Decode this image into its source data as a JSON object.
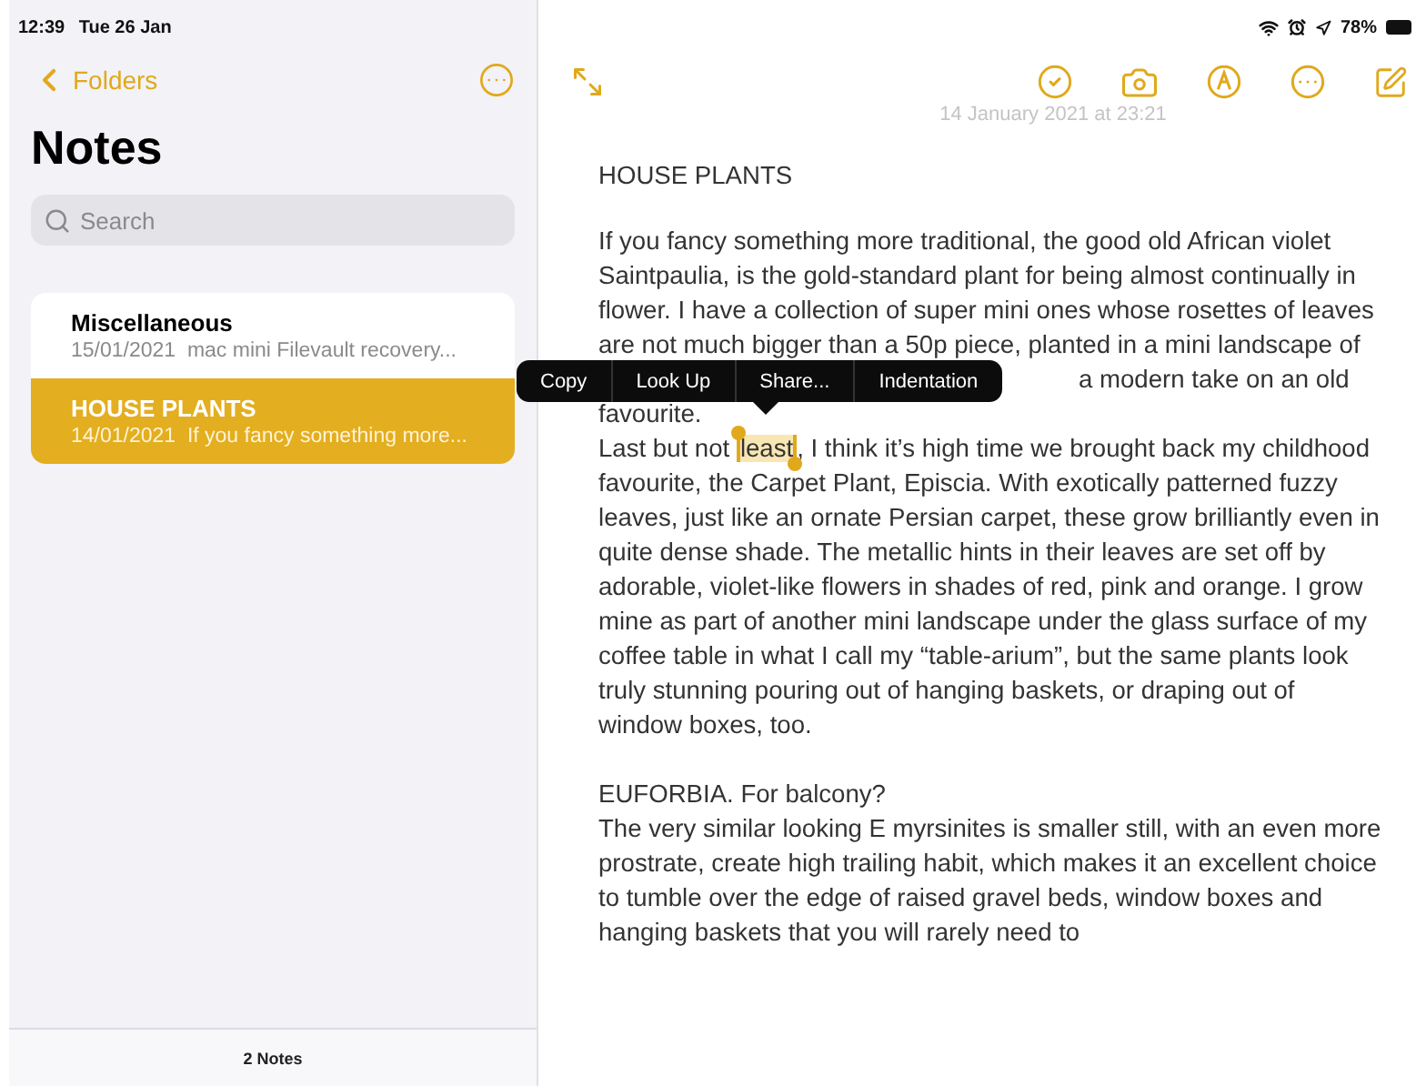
{
  "status_bar": {
    "time": "12:39",
    "date": "Tue 26 Jan",
    "battery": "78%"
  },
  "sidebar": {
    "back_label": "Folders",
    "title": "Notes",
    "search": {
      "placeholder": "Search"
    },
    "notes": [
      {
        "title": "Miscellaneous",
        "date": "15/01/2021",
        "preview": "mac mini Filevault recovery...",
        "selected": false
      },
      {
        "title": "HOUSE PLANTS",
        "date": "14/01/2021",
        "preview": "If you fancy something more...",
        "selected": true
      }
    ],
    "footer": "2 Notes"
  },
  "editor": {
    "date": "14 January 2021 at 23:21",
    "heading": "HOUSE PLANTS",
    "lines": [
      {
        "kind": "text",
        "text": "If you fancy something more traditional, the good old African violet"
      },
      {
        "kind": "text",
        "text": "Saintpaulia, is the gold-standard plant for being almost continually in"
      },
      {
        "kind": "text",
        "text": "flower. I have a collection of super mini ones whose rosettes of leaves"
      },
      {
        "kind": "text",
        "text": "are not much bigger than a 50p piece, planted in a mini landscape of"
      },
      {
        "kind": "covered",
        "text": "a modern take on an old"
      },
      {
        "kind": "text",
        "text": "favourite."
      },
      {
        "kind": "selection",
        "before": "Last but not ",
        "selected": "least",
        "after": ", I think it’s high time we brought back my childhood"
      },
      {
        "kind": "text",
        "text": "favourite, the Carpet Plant, Episcia. With exotically patterned fuzzy"
      },
      {
        "kind": "text",
        "text": "leaves, just like an ornate Persian carpet, these grow brilliantly even in"
      },
      {
        "kind": "text",
        "text": "quite dense shade. The metallic hints in their leaves are set off by"
      },
      {
        "kind": "text",
        "text": "adorable, violet-like flowers in shades of red, pink and orange. I grow"
      },
      {
        "kind": "text",
        "text": "mine as part of another mini landscape under the glass surface of my"
      },
      {
        "kind": "text",
        "text": "coffee table in what I call my “table-arium”, but the same plants look"
      },
      {
        "kind": "text",
        "text": "truly stunning pouring out of hanging baskets, or draping out of"
      },
      {
        "kind": "text",
        "text": "window boxes, too."
      },
      {
        "kind": "blank"
      },
      {
        "kind": "text",
        "text": "EUFORBIA. For balcony?"
      },
      {
        "kind": "text",
        "text": "The very similar looking E myrsinites is smaller still, with an even more"
      },
      {
        "kind": "text",
        "text": "prostrate, create high trailing habit, which makes it an excellent choice"
      },
      {
        "kind": "text",
        "text": "to tumble over the edge of raised gravel beds, window boxes and"
      },
      {
        "kind": "text",
        "text": "hanging baskets that you will rarely need to"
      }
    ],
    "context_menu": [
      "Copy",
      "Look Up",
      "Share...",
      "Indentation"
    ]
  }
}
